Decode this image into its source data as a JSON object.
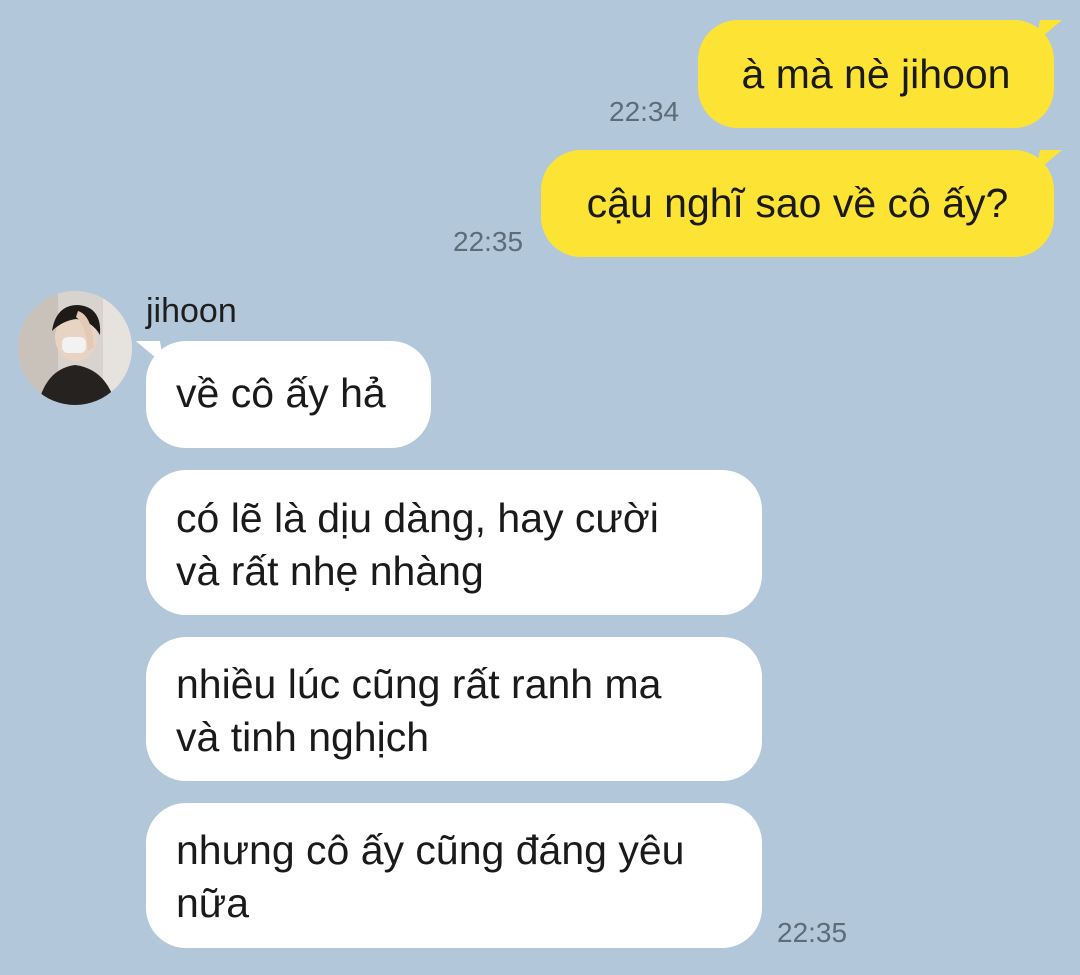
{
  "conversation": {
    "outgoing": [
      {
        "text": "à mà nè jihoon",
        "time": "22:34"
      },
      {
        "text": "cậu nghĩ sao về cô ấy?",
        "time": "22:35"
      }
    ],
    "incoming": {
      "sender_name": "jihoon",
      "avatar_icon": "profile-photo",
      "messages": [
        {
          "lines": [
            "về cô ấy hả"
          ]
        },
        {
          "lines": [
            "có lẽ là dịu dàng, hay cười",
            "và rất nhẹ nhàng"
          ]
        },
        {
          "lines": [
            "nhiều lúc cũng rất ranh ma",
            "và tinh nghịch"
          ]
        },
        {
          "lines": [
            "nhưng cô ấy cũng đáng yêu",
            "nữa"
          ]
        }
      ],
      "time": "22:35"
    }
  },
  "colors": {
    "background": "#b2c7da",
    "outgoing_bubble": "#fde434",
    "incoming_bubble": "#ffffff",
    "timestamp": "#5d6c79"
  }
}
